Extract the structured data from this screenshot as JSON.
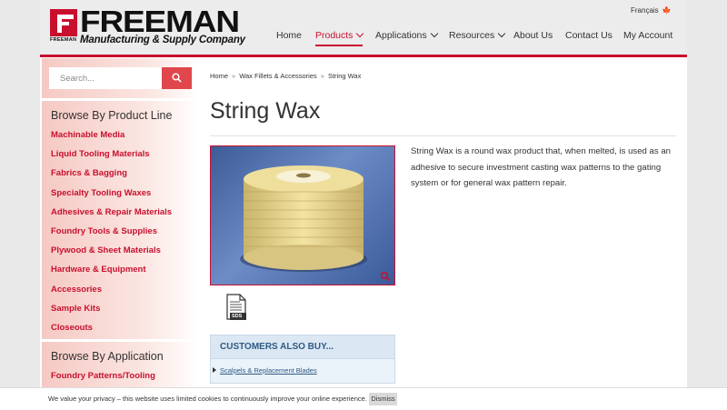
{
  "header": {
    "logo_big": "FREEMAN",
    "logo_sub": "Manufacturing & Supply Company",
    "logo_small": "FREEMAN",
    "language": "Français",
    "nav": [
      {
        "label": "Home"
      },
      {
        "label": "Products"
      },
      {
        "label": "Applications"
      },
      {
        "label": "Resources"
      },
      {
        "label": "About Us"
      },
      {
        "label": "Contact Us"
      },
      {
        "label": "My Account"
      }
    ]
  },
  "search": {
    "placeholder": "Search..."
  },
  "sidebar": {
    "product_line_heading": "Browse By Product Line",
    "product_lines": [
      "Machinable Media",
      "Liquid Tooling Materials",
      "Fabrics & Bagging",
      "Specialty Tooling Waxes",
      "Adhesives & Repair Materials",
      "Foundry Tools & Supplies",
      "Plywood & Sheet Materials",
      "Hardware & Equipment",
      "Accessories",
      "Sample Kits",
      "Closeouts"
    ],
    "application_heading": "Browse By Application",
    "applications": [
      "Foundry Patterns/Tooling"
    ]
  },
  "breadcrumb": [
    "Home",
    "Wax Fillets & Accessories",
    "String Wax"
  ],
  "product": {
    "title": "String Wax",
    "description": "String Wax is a round wax product that, when melted, is used as an adhesive to secure investment casting wax patterns to the gating system or for general wax pattern repair.",
    "sds_label": "SDS"
  },
  "also_buy": {
    "heading": "CUSTOMERS ALSO BUY...",
    "items": [
      "Scalpels & Replacement Blades"
    ]
  },
  "cookie": {
    "text": "We value your privacy – this website uses limited cookies to continuously improve your online experience.",
    "button": "Dismiss"
  },
  "colors": {
    "accent": "#c8102e",
    "link_blue": "#2e5a84"
  }
}
